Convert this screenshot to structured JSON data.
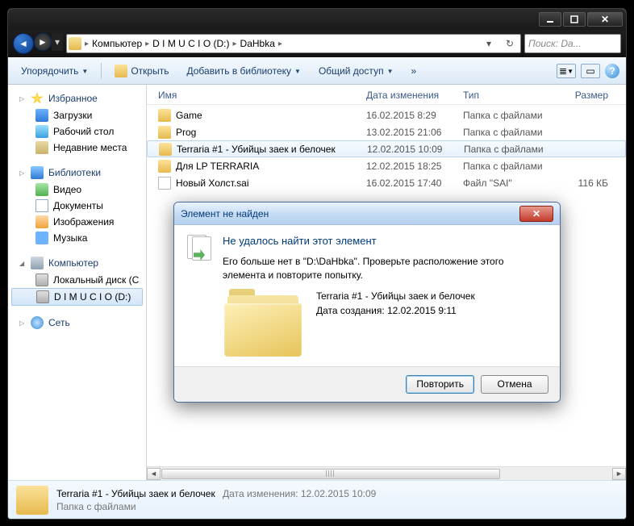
{
  "titlebar": {},
  "nav": {
    "crumbs": [
      "Компьютер",
      "D I M U C I O (D:)",
      "DaHbka"
    ],
    "search_placeholder": "Поиск: Da..."
  },
  "toolbar": {
    "organize": "Упорядочить",
    "open": "Открыть",
    "addlib": "Добавить в библиотеку",
    "share": "Общий доступ"
  },
  "columns": {
    "name": "Имя",
    "date": "Дата изменения",
    "type": "Тип",
    "size": "Размер"
  },
  "sidebar": {
    "favorites": "Избранное",
    "fav_items": [
      "Загрузки",
      "Рабочий стол",
      "Недавние места"
    ],
    "libraries": "Библиотеки",
    "lib_items": [
      "Видео",
      "Документы",
      "Изображения",
      "Музыка"
    ],
    "computer": "Компьютер",
    "comp_items": [
      "Локальный диск (C",
      "D I M U C I O (D:)"
    ],
    "network": "Сеть"
  },
  "files": [
    {
      "name": "Game",
      "date": "16.02.2015 8:29",
      "type": "Папка с файлами",
      "size": "",
      "icon": "folder"
    },
    {
      "name": "Prog",
      "date": "13.02.2015 21:06",
      "type": "Папка с файлами",
      "size": "",
      "icon": "folder"
    },
    {
      "name": "Terraria #1 - Убийцы заек и белочек",
      "date": "12.02.2015 10:09",
      "type": "Папка с файлами",
      "size": "",
      "icon": "folder",
      "selected": true
    },
    {
      "name": "Для LP TERRARIA",
      "date": "12.02.2015 18:25",
      "type": "Папка с файлами",
      "size": "",
      "icon": "folder"
    },
    {
      "name": "Новый Холст.sai",
      "date": "16.02.2015 17:40",
      "type": "Файл \"SAI\"",
      "size": "116 КБ",
      "icon": "file"
    }
  ],
  "status": {
    "name": "Terraria #1 - Убийцы заек и белочек",
    "meta_label": "Дата изменения:",
    "meta_value": "12.02.2015 10:09",
    "type": "Папка с файлами"
  },
  "dialog": {
    "title": "Элемент не найден",
    "heading": "Не удалось найти этот элемент",
    "body": "Его больше нет в \"D:\\DaHbka\". Проверьте расположение этого элемента и повторите попытку.",
    "item_name": "Terraria #1 - Убийцы заек и белочек",
    "created_label": "Дата создания: 12.02.2015 9:11",
    "retry": "Повторить",
    "cancel": "Отмена"
  }
}
